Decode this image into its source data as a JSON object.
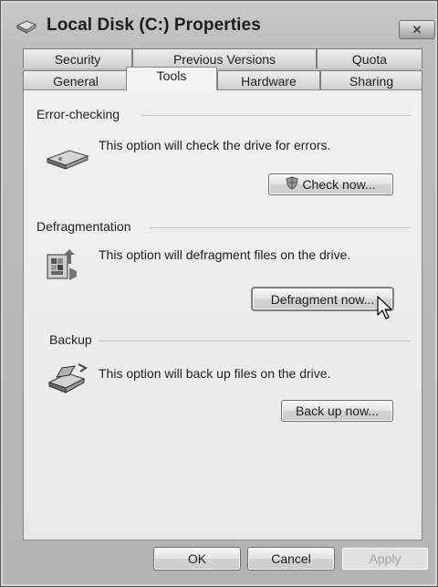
{
  "window": {
    "title": "Local Disk (C:) Properties",
    "close_glyph": "✕"
  },
  "tabs": {
    "row_back": [
      {
        "label": "Security"
      },
      {
        "label": "Previous Versions"
      },
      {
        "label": "Quota"
      }
    ],
    "row_front": [
      {
        "label": "General"
      },
      {
        "label": "Tools",
        "active": true
      },
      {
        "label": "Hardware"
      },
      {
        "label": "Sharing"
      }
    ]
  },
  "sections": {
    "error_checking": {
      "title": "Error-checking",
      "description": "This option will check the drive for errors.",
      "button": "Check now...",
      "icon": "drive-check-icon"
    },
    "defragmentation": {
      "title": "Defragmentation",
      "description": "This option will defragment files on the drive.",
      "button": "Defragment now...",
      "icon": "defragment-icon"
    },
    "backup": {
      "title": "Backup",
      "description": "This option will back up files on the drive.",
      "button": "Back up now...",
      "icon": "backup-icon"
    }
  },
  "footer": {
    "ok": "OK",
    "cancel": "Cancel",
    "apply": "Apply"
  }
}
